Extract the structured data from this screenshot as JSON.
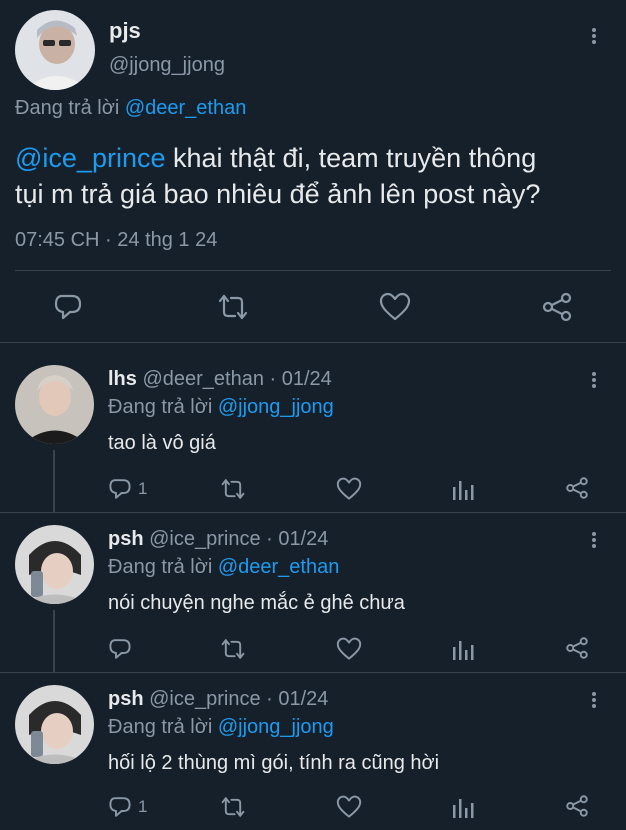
{
  "main_tweet": {
    "name": "pjs",
    "handle": "@jjong_jjong",
    "replying_label": "Đang trả lời",
    "replying_to": "@deer_ethan",
    "mention": "@ice_prince",
    "text_line1": " khai thật đi, team truyền thông",
    "text_line2": "tụi m trả giá bao nhiêu để ảnh lên post này?",
    "timestamp": "07:45 CH · 24 thg 1 24",
    "actions": [
      "reply-icon",
      "retweet-icon",
      "like-icon",
      "share-icon"
    ]
  },
  "replies": [
    {
      "name": "lhs",
      "handle_date": "@deer_ethan · 01/24",
      "replying_label": "Đang trả lời",
      "replying_to": "@jjong_jjong",
      "text": "tao là vô giá",
      "reply_count": "1"
    },
    {
      "name": "psh",
      "handle_date": "@ice_prince · 01/24",
      "replying_label": "Đang trả lời",
      "replying_to": "@deer_ethan",
      "text": "nói chuyện nghe mắc ẻ ghê chưa",
      "reply_count": ""
    },
    {
      "name": "psh",
      "handle_date": "@ice_prince · 01/24",
      "replying_label": "Đang trả lời",
      "replying_to": "@jjong_jjong",
      "text": "hối lộ 2 thùng mì gói, tính ra cũng hời",
      "reply_count": "1"
    }
  ],
  "colors": {
    "background": "#15202b",
    "text": "#e7e9ea",
    "muted": "#8b98a5",
    "link": "#1d9bf0",
    "divider": "#38444d"
  }
}
